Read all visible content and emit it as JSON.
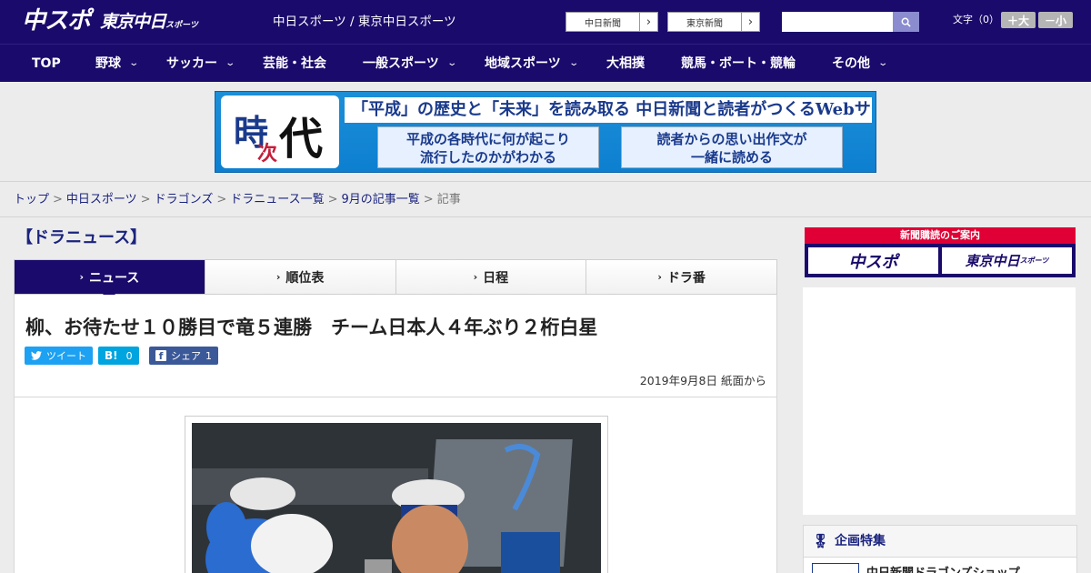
{
  "header": {
    "logo_main": "中スポ",
    "logo_sub": "東京中日",
    "logo_sub_small": "スポーツ",
    "site_names": "中日スポーツ / 東京中日スポーツ",
    "paper_buttons": [
      "中日新聞",
      "東京新聞"
    ],
    "font_label": "文字（0）",
    "font_bigger": "＋大",
    "font_smaller": "－小"
  },
  "nav": {
    "items": [
      {
        "label": "TOP",
        "dropdown": false
      },
      {
        "label": "野球",
        "dropdown": true
      },
      {
        "label": "サッカー",
        "dropdown": true
      },
      {
        "label": "芸能・社会",
        "dropdown": false
      },
      {
        "label": "一般スポーツ",
        "dropdown": true
      },
      {
        "label": "地域スポーツ",
        "dropdown": true
      },
      {
        "label": "大相撲",
        "dropdown": false
      },
      {
        "label": "競馬・ボート・競輪",
        "dropdown": false
      },
      {
        "label": "その他",
        "dropdown": true
      }
    ]
  },
  "banner": {
    "logo_ji": "時",
    "logo_ci": "次",
    "logo_dai": "代",
    "headline": "「平成」の歴史と「未来」を読み取る 中日新聞と読者がつくるWebサイト",
    "box_left_line1": "平成の各時代に何が起こり",
    "box_left_line2": "流行したのかがわかる",
    "box_right_line1": "読者からの思い出作文が",
    "box_right_line2": "一緒に読める"
  },
  "breadcrumb": {
    "items": [
      "トップ",
      "中日スポーツ",
      "ドラゴンズ",
      "ドラニュース一覧",
      "9月の記事一覧"
    ],
    "current": "記事",
    "separator": ">"
  },
  "section": {
    "title": "【ドラニュース】",
    "tabs": [
      "ニュース",
      "順位表",
      "日程",
      "ドラ番"
    ]
  },
  "article": {
    "title": "柳、お待たせ１０勝目で竜５連勝　チーム日本人４年ぶり２桁白星",
    "share_twitter": "ツイート",
    "share_hatena": "B!",
    "share_hatena_count": "0",
    "share_facebook": "シェア",
    "share_facebook_count": "1",
    "date": "2019年9月8日 紙面から"
  },
  "sidebar": {
    "subscribe_title": "新聞購読のご案内",
    "subscribe_left": "中スポ",
    "subscribe_right": "東京中日",
    "subscribe_right_small": "スポーツ",
    "feature_title": "企画特集",
    "feature_item": "中日新聞ドラゴンズショップ"
  },
  "colors": {
    "brand_navy": "#1a0a6b",
    "twitter": "#1da1f2",
    "hatena": "#00a4de",
    "facebook": "#3b5998",
    "subscribe_red": "#e00035"
  }
}
